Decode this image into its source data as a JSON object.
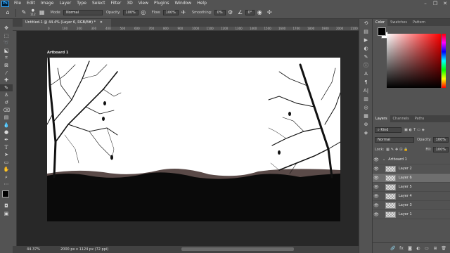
{
  "menubar": {
    "logo": "Ps",
    "items": [
      "File",
      "Edit",
      "Image",
      "Layer",
      "Type",
      "Select",
      "Filter",
      "3D",
      "View",
      "Plugins",
      "Window",
      "Help"
    ],
    "window_controls": [
      "–",
      "❐",
      "✕"
    ]
  },
  "options_bar": {
    "brush_size": "112",
    "mode_label": "Mode:",
    "mode_value": "Normal",
    "opacity_label": "Opacity:",
    "opacity_value": "100%",
    "flow_label": "Flow:",
    "flow_value": "100%",
    "smoothing_label": "Smoothing:",
    "smoothing_value": "0%",
    "angle_value": "0°"
  },
  "document": {
    "tab_title": "Untitled-1 @ 44.4% (Layer 6, RGB/8#) *",
    "artboard_name": "Artboard 1",
    "zoom": "44.37%",
    "doc_info": "2000 px x 1124 px (72 ppi)",
    "ruler_top": [
      "0",
      "100",
      "200",
      "300",
      "400",
      "500",
      "600",
      "700",
      "800",
      "900",
      "1000",
      "1100",
      "1200",
      "1300",
      "1400",
      "1500",
      "1600",
      "1700",
      "1800",
      "1900",
      "2000",
      "2100",
      "2200"
    ]
  },
  "color_panel": {
    "tabs": [
      "Color",
      "Swatches",
      "Pattern"
    ],
    "foreground": "#000000",
    "background": "#ffffff"
  },
  "layers_panel": {
    "tabs": [
      "Layers",
      "Channels",
      "Paths"
    ],
    "kind_label": "Kind",
    "blend_mode": "Normal",
    "opacity_label": "Opacity:",
    "opacity_value": "100%",
    "lock_label": "Lock:",
    "fill_label": "Fill:",
    "fill_value": "100%",
    "artboard_group": "Artboard 1",
    "layers": [
      {
        "name": "Layer 2",
        "selected": false
      },
      {
        "name": "Layer 6",
        "selected": true
      },
      {
        "name": "Layer 5",
        "selected": false
      },
      {
        "name": "Layer 4",
        "selected": false
      },
      {
        "name": "Layer 3",
        "selected": false
      },
      {
        "name": "Layer 1",
        "selected": false
      }
    ],
    "footer_icons": [
      "link-icon",
      "fx-icon",
      "mask-icon",
      "adjustment-icon",
      "group-icon",
      "new-layer-icon",
      "trash-icon"
    ]
  },
  "colors": {
    "accent": "#31a8ff",
    "panel_bg": "#535353",
    "canvas_bg": "#282828",
    "selected_layer": "#6e6e6e"
  }
}
